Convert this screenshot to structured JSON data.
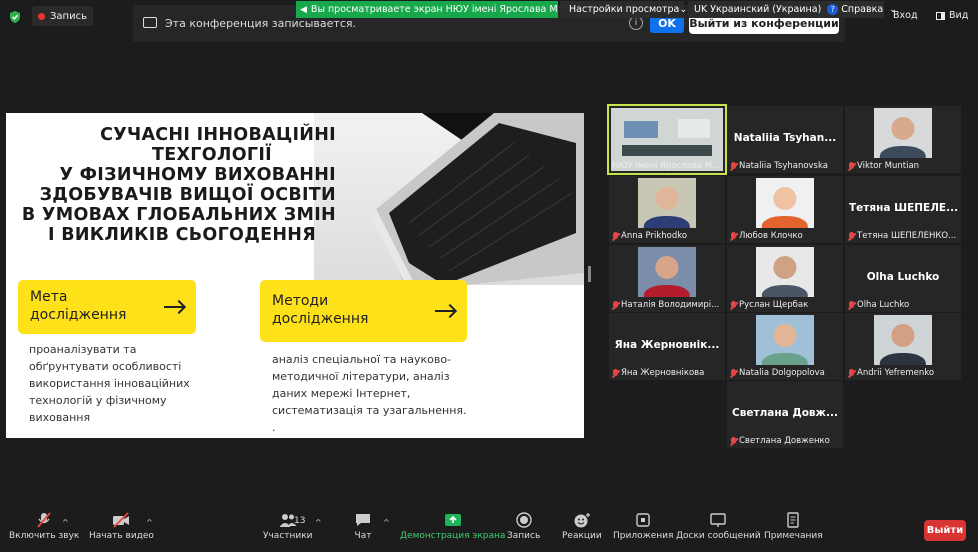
{
  "top": {
    "recording_label": "Запись",
    "share_notice": "Вы просматриваете экран НЮУ імені Ярослава Мудрого",
    "view_options": "Настройки просмотра",
    "language": "UK Украинский (Украина)",
    "help": "Справка",
    "enter_label": "Вход",
    "view_label": "Вид"
  },
  "banner": {
    "text": "Эта конференция записывается.",
    "ok_label": "OK",
    "leave_label": "Выйти из конференции"
  },
  "slide": {
    "title_lines": [
      "СУЧАСНІ ІННОВАЦІЙНІ",
      "ТЕХГОЛОГІЇ",
      "У ФІЗИЧНОМУ ВИХОВАННІ",
      "ЗДОБУВАЧІВ ВИЩОЇ ОСВІТИ",
      "В УМОВАХ ГЛОБАЛЬНИХ ЗМІН",
      "І ВИКЛИКІВ СЬОГОДЕННЯ"
    ],
    "box1_lines": [
      "Мета",
      "дослідження"
    ],
    "box2_lines": [
      "Методи",
      "дослідження"
    ],
    "para1_lines": [
      "проаналізувати та",
      "обґрунтувати особливості",
      "використання інноваційних",
      "технологій у фізичному",
      "виховання"
    ],
    "para2_lines": [
      "аналіз спеціальної та науково-",
      "методичної літератури, аналіз",
      "даних мережі Інтернет,",
      "систематизація та узагальнення.",
      "."
    ]
  },
  "participants": [
    {
      "name": "НЮУ імені Ярослава М...",
      "big": "",
      "video": true,
      "active": true,
      "muted": false
    },
    {
      "name": "Nataliia Tsyhanovska",
      "big": "Nataliia Tsyhan...",
      "video": false,
      "muted": true
    },
    {
      "name": "Viktor Muntian",
      "big": "",
      "video": true,
      "muted": true
    },
    {
      "name": "Anna Prikhodko",
      "big": "",
      "video": true,
      "muted": true
    },
    {
      "name": "Любов Клочко",
      "big": "",
      "video": true,
      "muted": true
    },
    {
      "name": "Тетяна ШЕПЕЛЕНКО...",
      "big": "Тетяна ШЕПЕЛЕ...",
      "video": false,
      "muted": true
    },
    {
      "name": "Наталія Володимирі...",
      "big": "",
      "video": true,
      "muted": true
    },
    {
      "name": "Руслан Щербак",
      "big": "",
      "video": true,
      "muted": true
    },
    {
      "name": "Olha Luchko",
      "big": "Olha Luchko",
      "video": false,
      "muted": true
    },
    {
      "name": "Яна Жерновнікова",
      "big": "Яна Жерновнік...",
      "video": false,
      "muted": true
    },
    {
      "name": "Natalia Dolgopolova",
      "big": "",
      "video": true,
      "muted": true
    },
    {
      "name": "Andrii Yefremenko",
      "big": "",
      "video": true,
      "muted": true
    },
    {
      "name": "Светлана Довженко",
      "big": "Светлана Довж...",
      "video": false,
      "muted": true
    }
  ],
  "toolbar": {
    "unmute": "Включить звук",
    "start_video": "Начать видео",
    "participants": "Участники",
    "participants_count": "13",
    "chat": "Чат",
    "share": "Демонстрация экрана",
    "record": "Запись",
    "reactions": "Реакции",
    "apps": "Приложения",
    "whiteboards": "Доски сообщений",
    "notes": "Примечания",
    "leave": "Выйти"
  },
  "colors": {
    "accent_green": "#17a84b",
    "slide_yellow": "#ffe11a",
    "leave_red": "#d93434",
    "active_border": "#c9e34a"
  }
}
